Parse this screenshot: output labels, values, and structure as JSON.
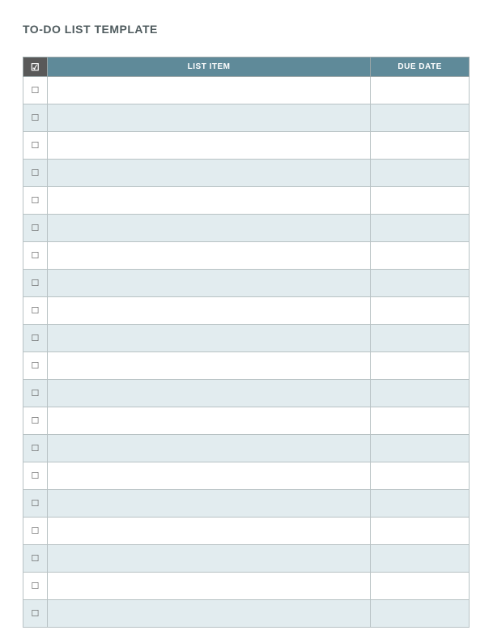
{
  "title": "TO-DO LIST TEMPLATE",
  "header": {
    "check": "☑",
    "item": "LIST ITEM",
    "date": "DUE DATE"
  },
  "rows": [
    {
      "checked": false,
      "item": "",
      "due": ""
    },
    {
      "checked": false,
      "item": "",
      "due": ""
    },
    {
      "checked": false,
      "item": "",
      "due": ""
    },
    {
      "checked": false,
      "item": "",
      "due": ""
    },
    {
      "checked": false,
      "item": "",
      "due": ""
    },
    {
      "checked": false,
      "item": "",
      "due": ""
    },
    {
      "checked": false,
      "item": "",
      "due": ""
    },
    {
      "checked": false,
      "item": "",
      "due": ""
    },
    {
      "checked": false,
      "item": "",
      "due": ""
    },
    {
      "checked": false,
      "item": "",
      "due": ""
    },
    {
      "checked": false,
      "item": "",
      "due": ""
    },
    {
      "checked": false,
      "item": "",
      "due": ""
    },
    {
      "checked": false,
      "item": "",
      "due": ""
    },
    {
      "checked": false,
      "item": "",
      "due": ""
    },
    {
      "checked": false,
      "item": "",
      "due": ""
    },
    {
      "checked": false,
      "item": "",
      "due": ""
    },
    {
      "checked": false,
      "item": "",
      "due": ""
    },
    {
      "checked": false,
      "item": "",
      "due": ""
    },
    {
      "checked": false,
      "item": "",
      "due": ""
    },
    {
      "checked": false,
      "item": "",
      "due": ""
    }
  ],
  "checkbox_glyph": "☐"
}
